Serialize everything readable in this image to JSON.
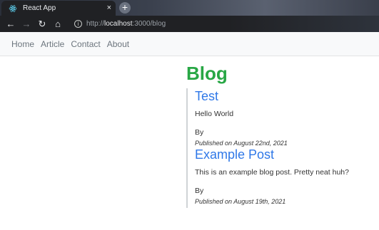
{
  "browser": {
    "tab_title": "React App",
    "tab_close": "×",
    "new_tab": "+",
    "url_prefix": "http://",
    "url_host": "localhost",
    "url_rest": ":3000/blog",
    "back": "←",
    "forward": "→",
    "reload": "↻",
    "home": "⌂",
    "info": "i"
  },
  "navbar": {
    "links": [
      "Home",
      "Article",
      "Contact",
      "About"
    ]
  },
  "page": {
    "title": "Blog",
    "posts": [
      {
        "title": "Test",
        "body": "Hello World",
        "by": "By",
        "published": "Published on August 22nd, 2021"
      },
      {
        "title": "Example Post",
        "body": "This is an example blog post. Pretty neat huh?",
        "by": "By",
        "published": "Published on August 19th, 2021"
      }
    ]
  },
  "colors": {
    "blog_title": "#28a745",
    "post_title": "#2f78e8",
    "nav_link": "#6c757d"
  }
}
